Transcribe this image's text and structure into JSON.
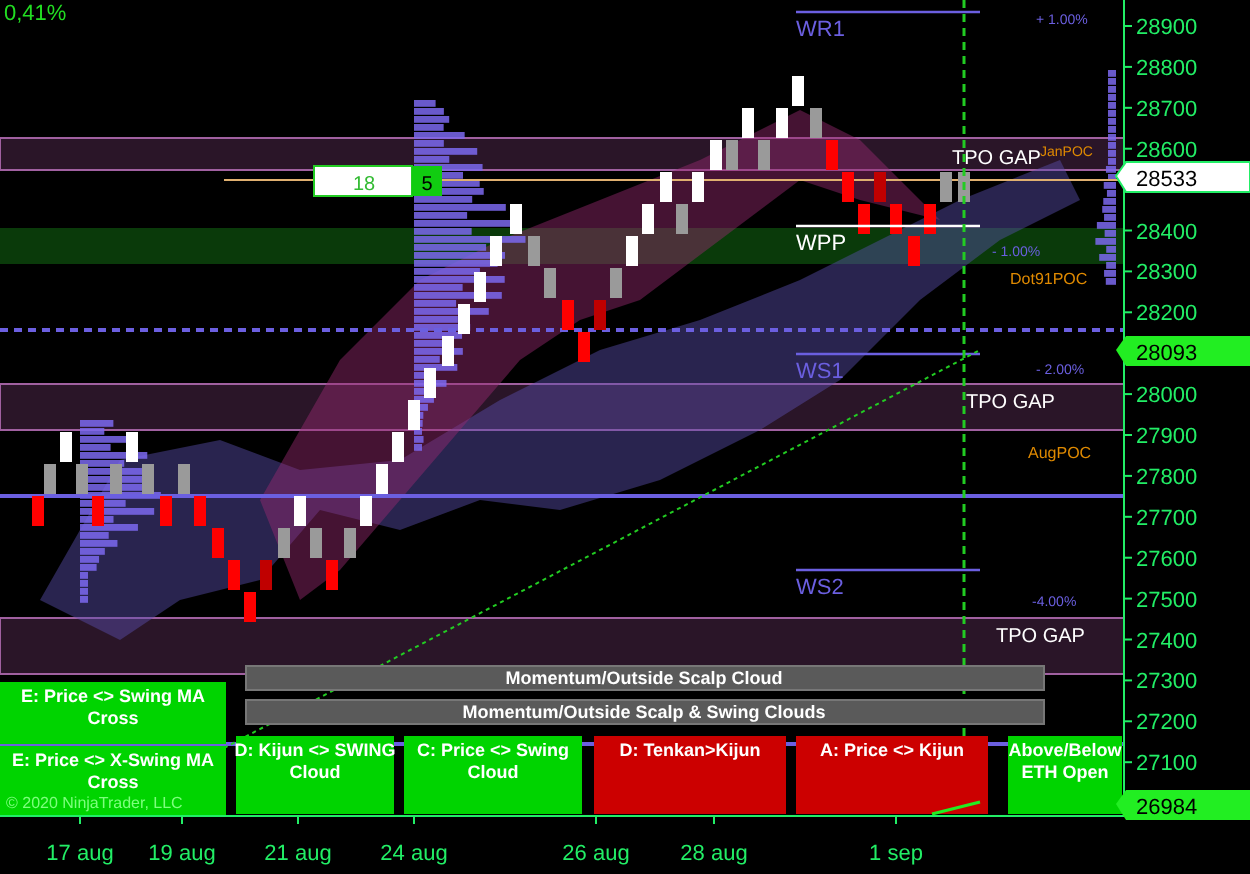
{
  "header": {
    "change": "0,41%"
  },
  "price_axis": {
    "ticks": [
      "28900",
      "28800",
      "28700",
      "28600",
      "28400",
      "28300",
      "28200",
      "28000",
      "27900",
      "27800",
      "27700",
      "27600",
      "27500",
      "27400",
      "27300",
      "27200",
      "27100"
    ],
    "last_price": "28533",
    "level_marker": "28093",
    "low_marker": "26984"
  },
  "time_axis": {
    "ticks": [
      "17 aug",
      "19 aug",
      "21 aug",
      "24 aug",
      "26 aug",
      "28 aug",
      "1 sep"
    ]
  },
  "pivots": [
    {
      "label": "WR1",
      "kind": "resistance"
    },
    {
      "label": "WPP",
      "kind": "central"
    },
    {
      "label": "WS1",
      "kind": "support"
    },
    {
      "label": "WS2",
      "kind": "support"
    }
  ],
  "zones": [
    {
      "label": "TPO GAP"
    },
    {
      "label": "TPO GAP"
    },
    {
      "label": "TPO GAP"
    }
  ],
  "percent_labels": [
    "+ 1.00%",
    "- 1.00%",
    "- 2.00%",
    "-4.00%"
  ],
  "poc_labels": [
    "JanPOC",
    "Dot91POC",
    "AugPOC"
  ],
  "bar_counter": {
    "value": "18",
    "count": "5"
  },
  "status_bars": [
    "Momentum/Outside Scalp Cloud",
    "Momentum/Outside Scalp & Swing  Clouds"
  ],
  "signals": [
    {
      "lines": [
        "E: Price <> Swing MA",
        "Cross"
      ],
      "color": "#00d400"
    },
    {
      "lines": [
        "E: Price <> X-Swing MA",
        "Cross"
      ],
      "color": "#00d400"
    },
    {
      "lines": [
        "D: Kijun <> SWING",
        "Cloud"
      ],
      "color": "#00d400"
    },
    {
      "lines": [
        "C: Price <> Swing",
        "Cloud"
      ],
      "color": "#00d400"
    },
    {
      "lines": [
        "D: Tenkan>Kijun"
      ],
      "color": "#cc0000"
    },
    {
      "lines": [
        "A: Price <> Kijun"
      ],
      "color": "#cc0000"
    },
    {
      "lines": [
        "Above/Below",
        "ETH Open"
      ],
      "color": "#00d400"
    }
  ],
  "copyright": "© 2020 NinjaTrader, LLC"
}
